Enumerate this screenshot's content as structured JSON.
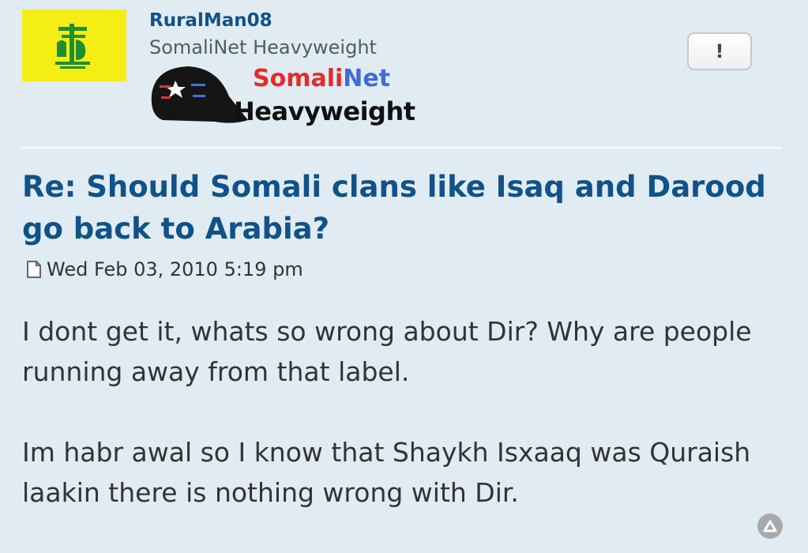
{
  "author": {
    "username": "RuralMan08",
    "rank_title": "SomaliNet Heavyweight",
    "rank_image": {
      "brand_part1": "Somali",
      "brand_part2": "Net",
      "level": "Heavyweight"
    },
    "avatar_icon": "flag-emblem-icon"
  },
  "report_button": {
    "label": "!"
  },
  "post": {
    "title": "Re: Should Somali clans like Isaq and Darood go back to Arabia?",
    "timestamp": "Wed Feb 03, 2010 5:19 pm",
    "paragraphs": [
      "I dont get it, whats so wrong about Dir? Why are people running away from that label.",
      "Im habr awal so I know that Shaykh Isxaaq was Quraish laakin there is nothing wrong with Dir."
    ]
  },
  "colors": {
    "background": "#e1ebf2",
    "link": "#105289",
    "avatar_bg": "#f5ee15",
    "brand_red": "#e32b2b",
    "brand_blue": "#3f6cd8"
  }
}
